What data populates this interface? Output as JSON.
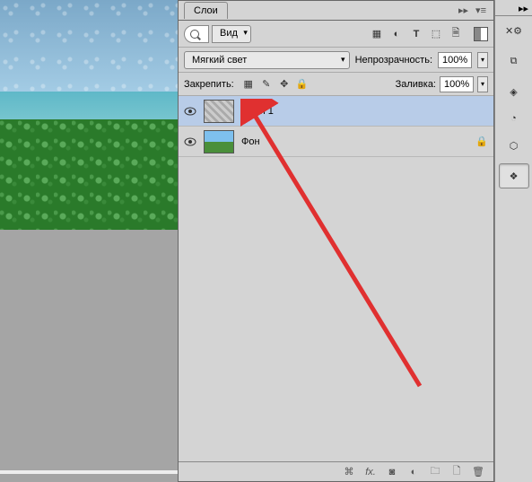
{
  "panel": {
    "title": "Слои",
    "filter_label": "Вид",
    "blend_mode": "Мягкий свет",
    "opacity_label": "Непрозрачность:",
    "opacity_value": "100%",
    "fill_label": "Заливка:",
    "fill_value": "100%",
    "lock_label": "Закрепить:"
  },
  "layers": [
    {
      "name": "Слой 1",
      "visible": true,
      "selected": true,
      "locked": false,
      "thumb": "pattern"
    },
    {
      "name": "Фон",
      "visible": true,
      "selected": false,
      "locked": true,
      "thumb": "scene"
    }
  ],
  "footer_icons": [
    "link",
    "fx",
    "mask",
    "adjustment",
    "group",
    "new",
    "trash"
  ],
  "right_tools": [
    "tools-icon",
    "brushes-icon",
    "swatches-icon",
    "cube-icon",
    "channels-icon",
    "paths-icon",
    "layers-icon"
  ]
}
